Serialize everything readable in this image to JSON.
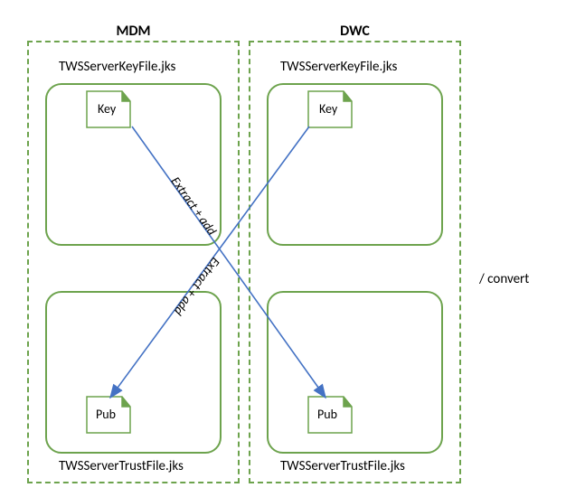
{
  "columns": {
    "left": {
      "title": "MDM",
      "topFile": "TWSServerKeyFile.jks",
      "topBoxLabel": "Key",
      "bottomBoxLabel": "Pub",
      "bottomFile": "TWSServerTrustFile.jks"
    },
    "right": {
      "title": "DWC",
      "topFile": "TWSServerKeyFile.jks",
      "topBoxLabel": "Key",
      "bottomBoxLabel": "Pub",
      "bottomFile": "TWSServerTrustFile.jks"
    }
  },
  "arrows": {
    "label1": "Extract + add",
    "label2": "Extract + add"
  },
  "sideLabel": "/ convert",
  "colors": {
    "green": "#6da34d",
    "arrowBlue": "#4472c4"
  }
}
